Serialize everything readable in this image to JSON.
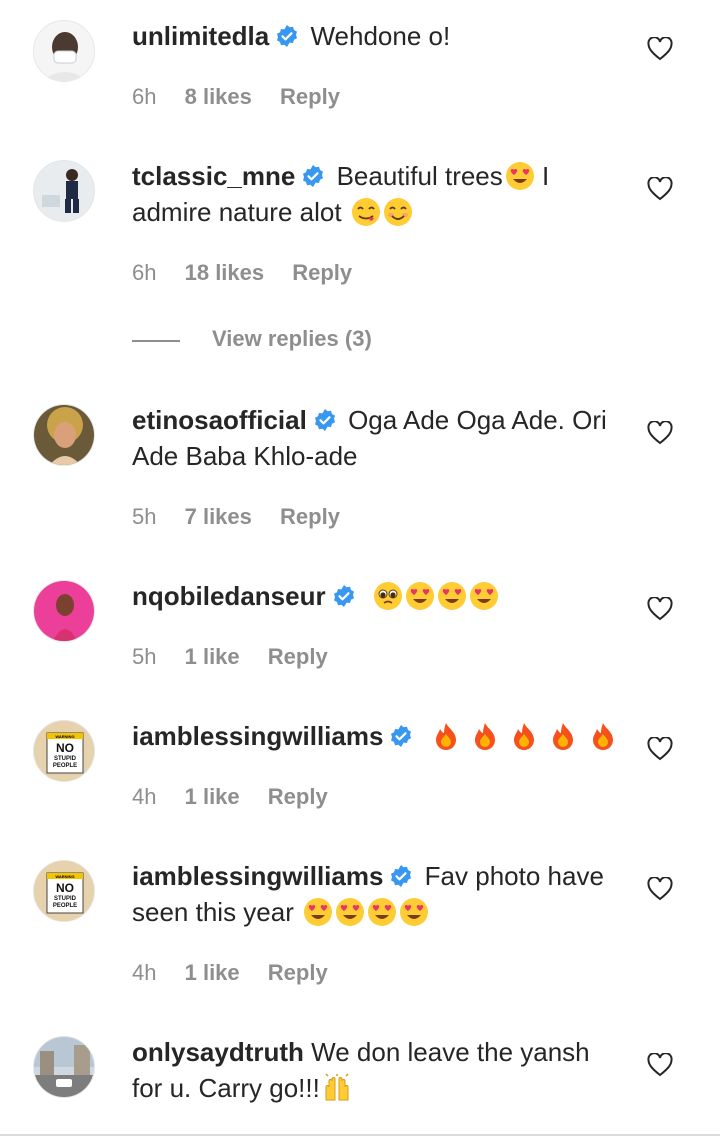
{
  "comments": [
    {
      "username": "unlimitedla",
      "verified": true,
      "text": "Wehdone o!",
      "emojis": [],
      "time": "6h",
      "likes": "8 likes",
      "reply": "Reply"
    },
    {
      "username": "tclassic_mne",
      "verified": true,
      "text": "Beautiful trees",
      "emojis_mid": [
        "heart-eyes"
      ],
      "text2": " I admire nature alot ",
      "emojis": [
        "yum",
        "smile"
      ],
      "time": "6h",
      "likes": "18 likes",
      "reply": "Reply"
    },
    {
      "username": "etinosaofficial",
      "verified": true,
      "text": "Oga Ade Oga Ade. Ori Ade Baba Khlo-ade",
      "emojis": [],
      "time": "5h",
      "likes": "7 likes",
      "reply": "Reply"
    },
    {
      "username": "nqobiledanseur",
      "verified": true,
      "text": "",
      "emojis": [
        "pleading",
        "heart-eyes",
        "heart-eyes",
        "heart-eyes"
      ],
      "time": "5h",
      "likes": "1 like",
      "reply": "Reply"
    },
    {
      "username": "iamblessingwilliams",
      "verified": true,
      "text": "",
      "emojis": [
        "fire",
        "fire",
        "fire",
        "fire",
        "fire"
      ],
      "time": "4h",
      "likes": "1 like",
      "reply": "Reply"
    },
    {
      "username": "iamblessingwilliams",
      "verified": true,
      "text": "Fav photo have seen this year ",
      "emojis": [
        "heart-eyes",
        "heart-eyes",
        "heart-eyes",
        "heart-eyes"
      ],
      "time": "4h",
      "likes": "1 like",
      "reply": "Reply"
    },
    {
      "username": "onlysaydtruth",
      "verified": false,
      "text": "We don leave the yansh for u. Carry go!!!",
      "emojis": [
        "raising-hands"
      ],
      "time": "",
      "likes": "",
      "reply": ""
    }
  ],
  "view_replies": "View replies (3)",
  "avatar_sign": {
    "line1": "WARNING",
    "line2": "NO",
    "line3": "STUPID",
    "line4": "PEOPLE"
  },
  "colors": {
    "text": "#262626",
    "meta": "#8e8e8e",
    "verified": "#3897f0"
  }
}
